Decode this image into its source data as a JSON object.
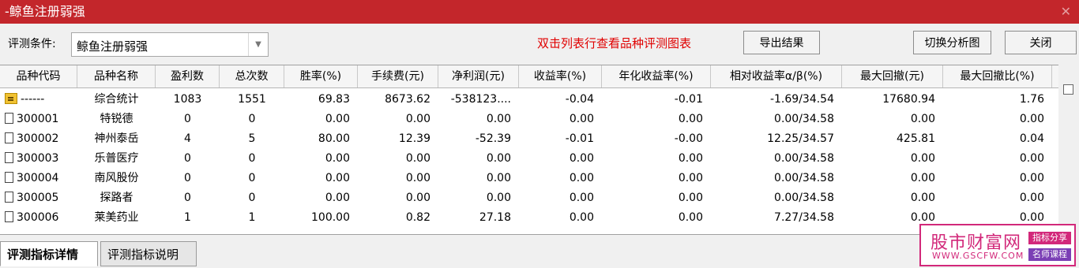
{
  "window": {
    "title": "-鲸鱼注册弱强"
  },
  "toolbar": {
    "condition_label": "评测条件:",
    "condition_value": "鲸鱼注册弱强",
    "hint": "双击列表行查看品种评测图表",
    "export_label": "导出结果",
    "switch_label": "切换分析图",
    "close_label": "关闭"
  },
  "table": {
    "headers": [
      "品种代码",
      "品种名称",
      "盈利数",
      "总次数",
      "胜率(%)",
      "手续费(元)",
      "净利润(元)",
      "收益率(%)",
      "年化收益率(%)",
      "相对收益率α/β(%)",
      "最大回撤(元)",
      "最大回撤比(%)"
    ],
    "rows": [
      {
        "icon": "folder-icon",
        "code": "------",
        "name": "综合统计",
        "win": "1083",
        "total": "1551",
        "rate": "69.83",
        "fee": "8673.62",
        "profit": "-538123....",
        "ret": "-0.04",
        "annual": "-0.01",
        "relative": "-1.69/34.54",
        "maxdd": "17680.94",
        "maxddr": "1.76"
      },
      {
        "icon": "document-icon",
        "code": "300001",
        "name": "特锐德",
        "win": "0",
        "total": "0",
        "rate": "0.00",
        "fee": "0.00",
        "profit": "0.00",
        "ret": "0.00",
        "annual": "0.00",
        "relative": "0.00/34.58",
        "maxdd": "0.00",
        "maxddr": "0.00"
      },
      {
        "icon": "document-icon",
        "code": "300002",
        "name": "神州泰岳",
        "win": "4",
        "total": "5",
        "rate": "80.00",
        "fee": "12.39",
        "profit": "-52.39",
        "ret": "-0.01",
        "annual": "-0.00",
        "relative": "12.25/34.57",
        "maxdd": "425.81",
        "maxddr": "0.04"
      },
      {
        "icon": "document-icon",
        "code": "300003",
        "name": "乐普医疗",
        "win": "0",
        "total": "0",
        "rate": "0.00",
        "fee": "0.00",
        "profit": "0.00",
        "ret": "0.00",
        "annual": "0.00",
        "relative": "0.00/34.58",
        "maxdd": "0.00",
        "maxddr": "0.00"
      },
      {
        "icon": "document-icon",
        "code": "300004",
        "name": "南风股份",
        "win": "0",
        "total": "0",
        "rate": "0.00",
        "fee": "0.00",
        "profit": "0.00",
        "ret": "0.00",
        "annual": "0.00",
        "relative": "0.00/34.58",
        "maxdd": "0.00",
        "maxddr": "0.00"
      },
      {
        "icon": "document-icon",
        "code": "300005",
        "name": "探路者",
        "win": "0",
        "total": "0",
        "rate": "0.00",
        "fee": "0.00",
        "profit": "0.00",
        "ret": "0.00",
        "annual": "0.00",
        "relative": "0.00/34.58",
        "maxdd": "0.00",
        "maxddr": "0.00"
      },
      {
        "icon": "document-icon",
        "code": "300006",
        "name": "莱美药业",
        "win": "1",
        "total": "1",
        "rate": "100.00",
        "fee": "0.82",
        "profit": "27.18",
        "ret": "0.00",
        "annual": "0.00",
        "relative": "7.27/34.58",
        "maxdd": "0.00",
        "maxddr": "0.00"
      }
    ]
  },
  "tabs": [
    {
      "label": "评测指标详情",
      "active": true
    },
    {
      "label": "评测指标说明",
      "active": false
    }
  ],
  "watermark": {
    "name": "股市财富网",
    "url": "WWW.GSCFW.COM",
    "tag1": "指标分享",
    "tag2": "名师课程"
  },
  "colors": {
    "titlebar": "#c3262b",
    "hint": "#e00000",
    "watermark": "#d2287a"
  }
}
